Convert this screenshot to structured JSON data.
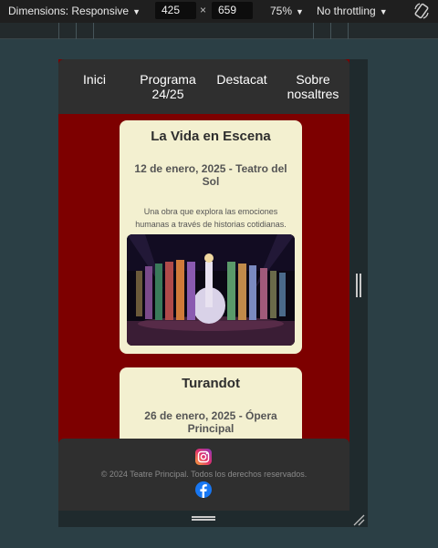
{
  "devtools": {
    "dimensions_label": "Dimensions: Responsive",
    "width_value": "425",
    "height_value": "659",
    "times_symbol": "×",
    "zoom": "75%",
    "throttling": "No throttling",
    "caret": "▼"
  },
  "nav": {
    "items": [
      {
        "label": "Inici"
      },
      {
        "label": "Programa 24/25"
      },
      {
        "label": "Destacat"
      },
      {
        "label": "Sobre nosaltres"
      }
    ]
  },
  "events": [
    {
      "title": "La Vida en Escena",
      "date": "12 de enero, 2025 - Teatro del Sol",
      "description": "Una obra que explora las emociones humanas a través de historias cotidianas."
    },
    {
      "title": "Turandot",
      "date": "26 de enero, 2025 - Ópera Principal"
    }
  ],
  "footer": {
    "copyright": "© 2024 Teatre Principal. Todos los derechos reservados.",
    "social": [
      "instagram-icon",
      "facebook-icon"
    ]
  },
  "colors": {
    "page_background": "#7d0000",
    "card_background": "#f3f0d0",
    "nav_background": "#2f2f2f"
  }
}
